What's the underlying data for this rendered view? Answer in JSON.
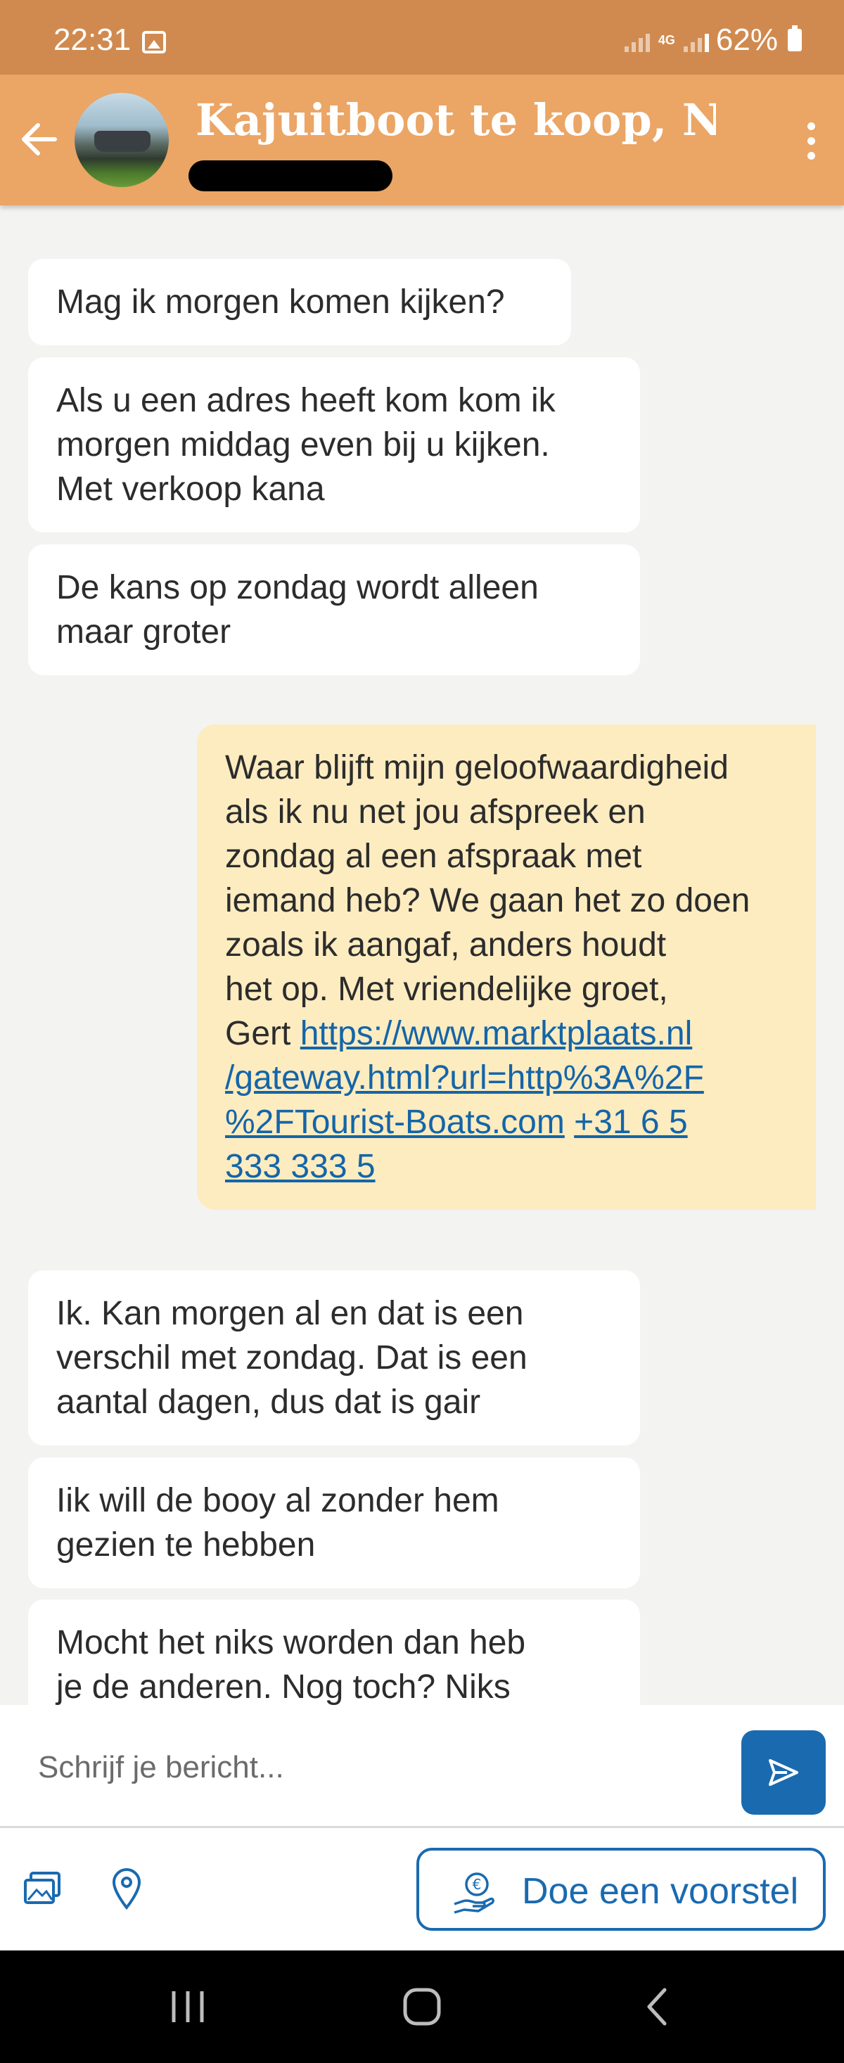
{
  "status_bar": {
    "time": "22:31",
    "network": "4G",
    "battery": "62%"
  },
  "header": {
    "title": "Kajuitboot te koop, Nid..."
  },
  "messages": [
    {
      "direction": "incoming",
      "text": "Mag ik morgen komen kijken?"
    },
    {
      "direction": "incoming",
      "lines": [
        "Als u een adres heeft kom kom ik",
        "morgen middag even bij u kijken.",
        "Met verkoop kana"
      ]
    },
    {
      "direction": "incoming",
      "lines": [
        "De kans op zondag wordt alleen",
        "maar groter"
      ]
    },
    {
      "direction": "outgoing",
      "lines": [
        "Waar blijft mijn geloofwaardigheid",
        "als ik nu net jou afspreek en",
        "zondag al een afspraak met",
        "iemand heb? We gaan het zo doen",
        "zoals ik aangaf, anders houdt",
        "het op. Met vriendelijke groet,"
      ],
      "signature": "Gert",
      "link_url_1": "https://www.marktplaats.nl",
      "link_url_2": "/gateway.html?url=http%3A%2F",
      "link_url_3": "%2FTourist-Boats.com",
      "phone_1": "+31 6 5",
      "phone_2": "333 333 5"
    },
    {
      "direction": "incoming",
      "lines": [
        "Ik. Kan morgen al en dat is een",
        "verschil met zondag. Dat is een",
        "aantal dagen, dus dat is gair"
      ]
    },
    {
      "direction": "incoming",
      "lines": [
        "Iik will de booy al zonder hem",
        "gezien te hebben"
      ]
    },
    {
      "direction": "incoming",
      "lines": [
        "Mocht het niks worden dan heb",
        "je de anderen. Nog toch? Niks"
      ]
    }
  ],
  "composer": {
    "placeholder": "Schrijf je bericht..."
  },
  "toolbar": {
    "offer_label": "Doe een voorstel"
  },
  "icons": {
    "back": "arrow-left-icon",
    "menu": "more-vertical-icon",
    "send": "send-icon",
    "gallery": "image-gallery-icon",
    "location": "location-pin-icon",
    "offer": "euro-hand-icon"
  },
  "colors": {
    "status_bar": "#d08a4f",
    "header": "#eba565",
    "outgoing_bubble": "#fdecc0",
    "accent": "#1a6ab0"
  }
}
